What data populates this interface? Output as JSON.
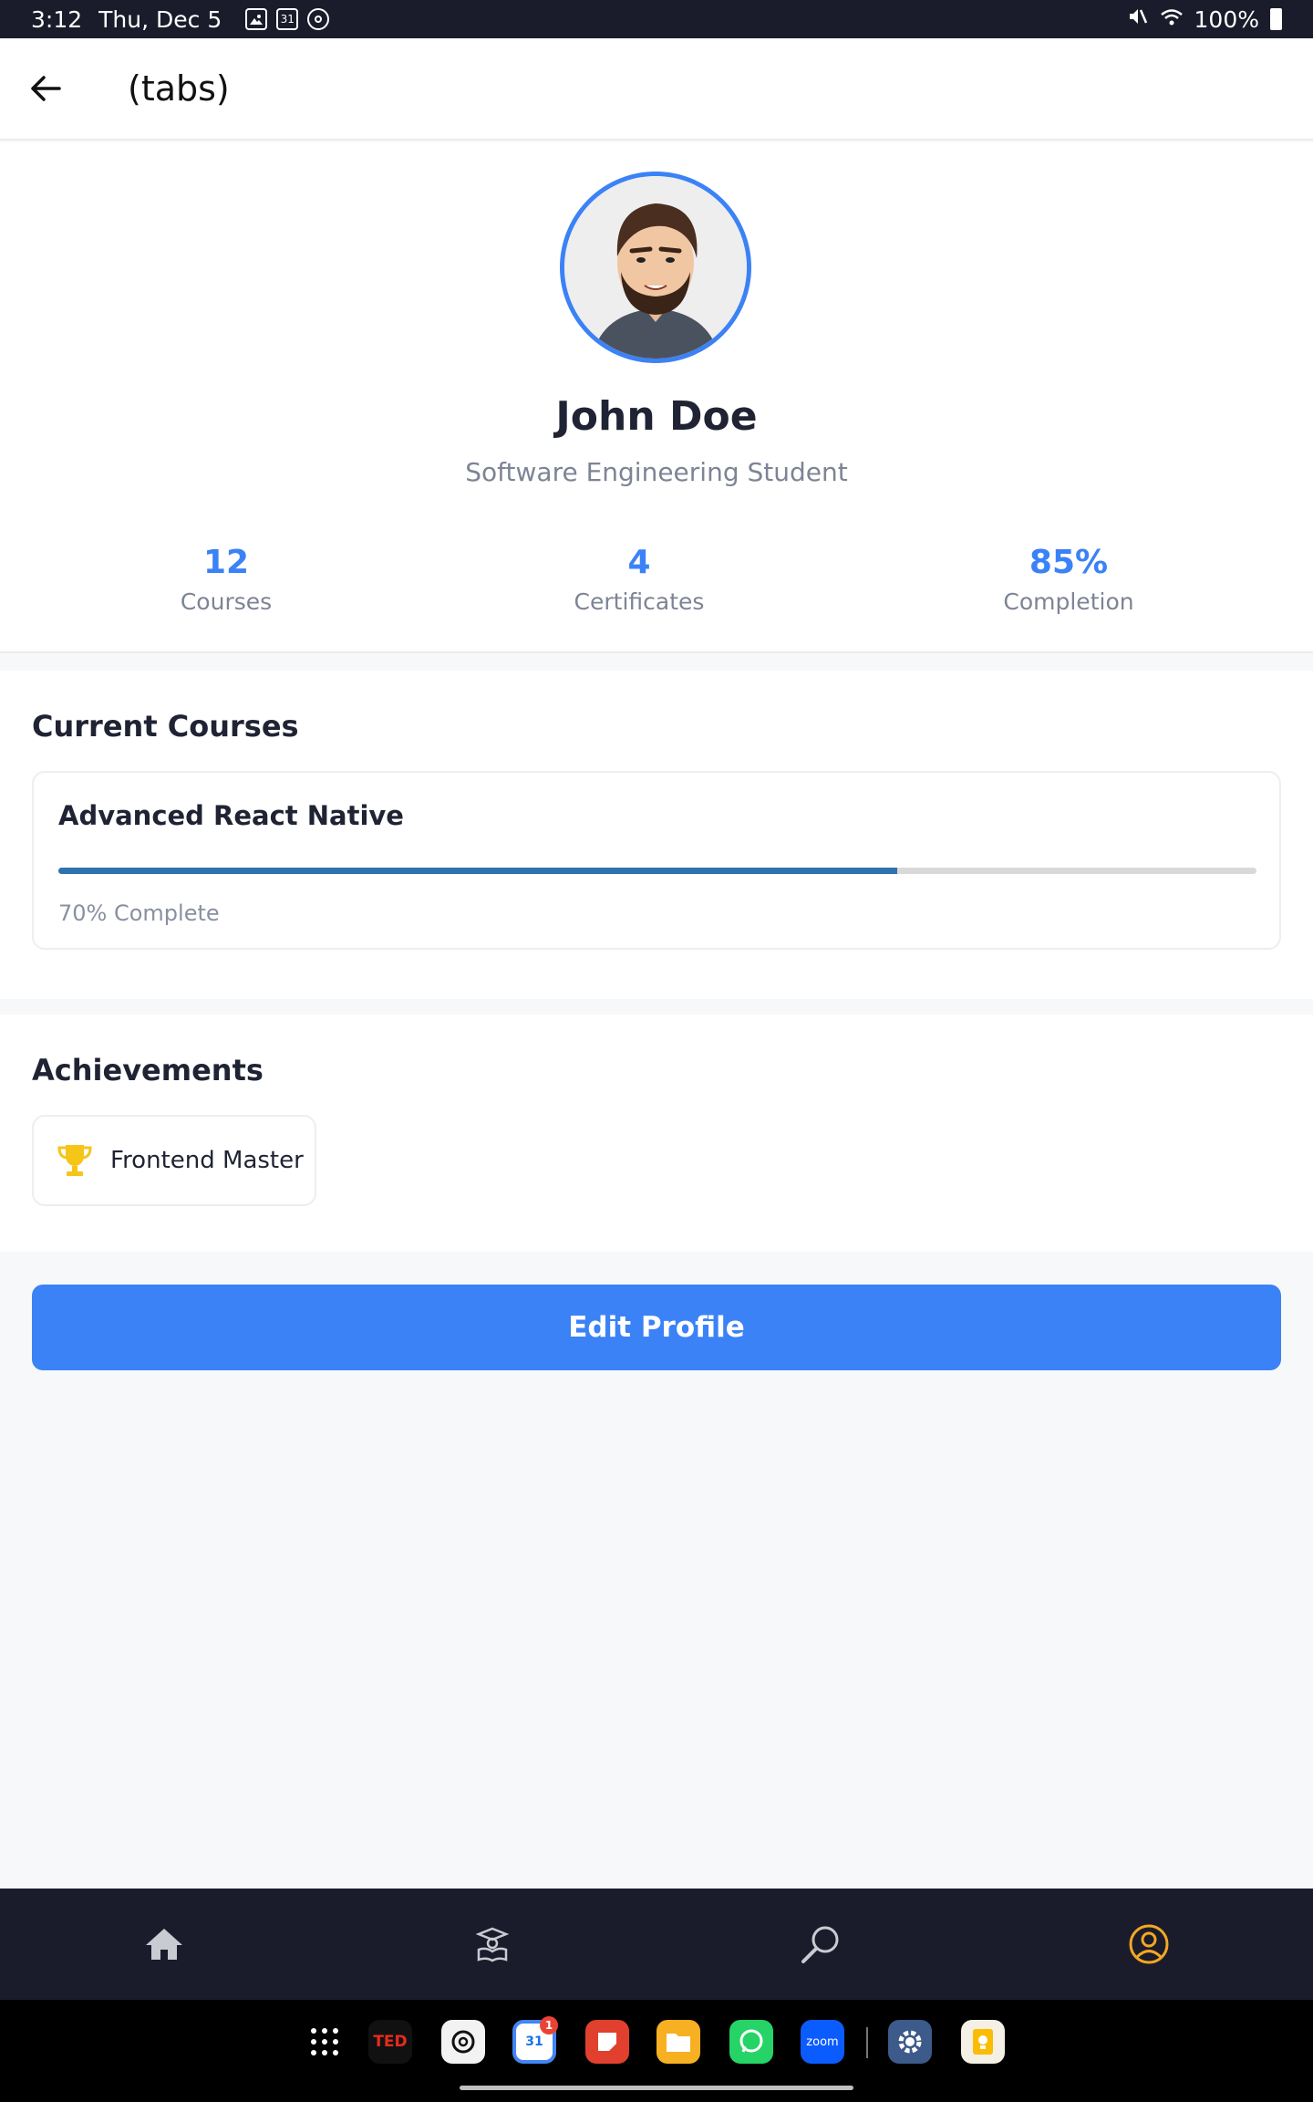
{
  "status_bar": {
    "time": "3:12",
    "date": "Thu, Dec 5",
    "calendar_day": "31",
    "battery": "100%"
  },
  "header": {
    "title": "(tabs)"
  },
  "profile": {
    "name": "John Doe",
    "subtitle": "Software Engineering Student",
    "stats": [
      {
        "value": "12",
        "label": "Courses"
      },
      {
        "value": "4",
        "label": "Certificates"
      },
      {
        "value": "85%",
        "label": "Completion"
      }
    ]
  },
  "current_courses": {
    "title": "Current Courses",
    "courses": [
      {
        "title": "Advanced React Native",
        "progress": 0.7,
        "progress_label": "70% Complete"
      }
    ]
  },
  "achievements": {
    "title": "Achievements",
    "items": [
      {
        "label": "Frontend Master",
        "icon": "trophy-icon"
      }
    ]
  },
  "edit_button": {
    "label": "Edit Profile"
  },
  "tab_bar": {
    "tabs": [
      {
        "icon": "home-icon",
        "active": false
      },
      {
        "icon": "courses-icon",
        "active": false
      },
      {
        "icon": "search-icon",
        "active": false
      },
      {
        "icon": "profile-icon",
        "active": true
      }
    ],
    "active_color": "#f5a623",
    "inactive_color": "#c9cbd3"
  },
  "dock": {
    "apps": [
      "apps-grid",
      "TED",
      "ChatGPT",
      "Calendar",
      "Notes",
      "Files",
      "WhatsApp",
      "zoom",
      "Settings",
      "Keep"
    ],
    "ted_label": "TED",
    "zoom_label": "zoom",
    "calendar_label": "31",
    "calendar_badge": "1"
  },
  "colors": {
    "accent": "#3b82f6",
    "progress": "#2f72ad",
    "trophy": "#f5c518"
  }
}
